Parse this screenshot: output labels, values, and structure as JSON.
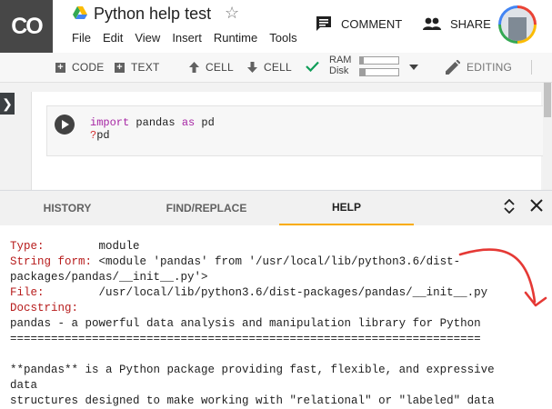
{
  "app": {
    "logo": "CO",
    "title": "Python help test",
    "menu": [
      "File",
      "Edit",
      "View",
      "Insert",
      "Runtime",
      "Tools"
    ],
    "comment_label": "COMMENT",
    "share_label": "SHARE"
  },
  "toolbar": {
    "add_code": "CODE",
    "add_text": "TEXT",
    "cell_up": "CELL",
    "cell_down": "CELL",
    "ram_label": "RAM",
    "disk_label": "Disk",
    "ram_usage_fraction": 0.1,
    "disk_usage_fraction": 0.15,
    "editing_label": "EDITING"
  },
  "cell": {
    "line1": {
      "kw1": "import",
      "mid": " pandas ",
      "kw2": "as",
      "end": " pd"
    },
    "line2": {
      "q": "?",
      "rest": "pd"
    }
  },
  "panel": {
    "tabs": [
      "HISTORY",
      "FIND/REPLACE",
      "HELP"
    ],
    "active_tab": "HELP"
  },
  "help": {
    "type_key": "Type:",
    "type_val": "        module",
    "form_key": "String form:",
    "form_val": " <module 'pandas' from '/usr/local/lib/python3.6/dist-",
    "form_val2": "packages/pandas/__init__.py'>",
    "file_key": "File:",
    "file_val": "        /usr/local/lib/python3.6/dist-packages/pandas/__init__.py",
    "doc_key": "Docstring:",
    "doc_line1": "pandas - a powerful data analysis and manipulation library for Python",
    "doc_rule": "=====================================================================",
    "doc_line3": "**pandas** is a Python package providing fast, flexible, and expressive",
    "doc_line4": "data",
    "doc_line5": "structures designed to make working with \"relational\" or \"labeled\" data"
  },
  "colors": {
    "accent_tab": "#f9ab00",
    "annotation_arrow": "#e53935",
    "help_keys": "#b71c1c"
  }
}
